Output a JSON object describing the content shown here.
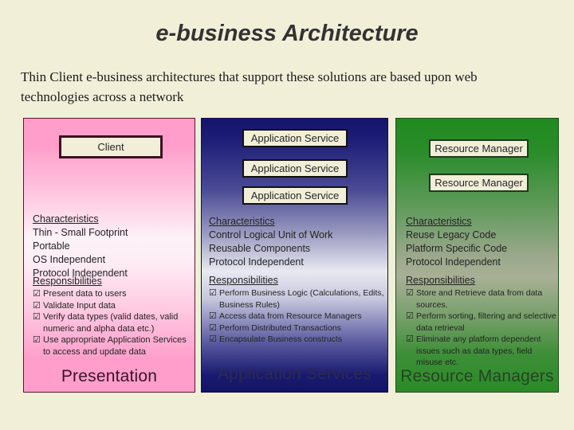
{
  "slide": {
    "title": "e-business Architecture",
    "subtitle": "Thin Client e-business architectures that support these solutions are based upon web technologies across a network"
  },
  "columns": [
    {
      "id": "client",
      "footer": "Presentation",
      "accent": "#ff9ecb",
      "nodes": [
        {
          "label": "Client"
        }
      ],
      "characteristics_header": "Characteristics",
      "characteristics": [
        "Thin - Small Footprint",
        "Portable",
        "OS Independent",
        "Protocol Independent"
      ],
      "responsibilities_header": "Responsibilities",
      "responsibilities": [
        "Present data to users",
        "Validate Input data",
        "Verify data types (valid dates, valid numeric and alpha data etc.)",
        "Use appropriate Application Services to access and update data"
      ]
    },
    {
      "id": "application-services",
      "footer": "Application Services",
      "accent": "#191970",
      "nodes": [
        {
          "label": "Application Service"
        },
        {
          "label": "Application Service"
        },
        {
          "label": "Application Service"
        }
      ],
      "characteristics_header": "Characteristics",
      "characteristics": [
        "Control Logical Unit of Work",
        "Reusable Components",
        "Protocol Independent"
      ],
      "responsibilities_header": "Responsibilities",
      "responsibilities": [
        "Perform Business Logic (Calculations, Edits, Business Rules)",
        "Access data from Resource Managers",
        "Perform Distributed Transactions",
        "Encapsulate Business constructs"
      ]
    },
    {
      "id": "resource-managers",
      "footer": "Resource Managers",
      "accent": "#228b22",
      "nodes": [
        {
          "label": "Resource Manager"
        },
        {
          "label": "Resource Manager"
        }
      ],
      "characteristics_header": "Characteristics",
      "characteristics": [
        "Reuse Legacy Code",
        "Platform Specific Code",
        "Protocol Independent"
      ],
      "responsibilities_header": "Responsibilities",
      "responsibilities": [
        "Store and Retrieve data from data sources.",
        "Perform sorting, filtering and selective data retrieval",
        "Eliminate any platform dependent issues such as data types, field misuse etc."
      ]
    }
  ],
  "icons": {
    "checkbox": "☑"
  }
}
